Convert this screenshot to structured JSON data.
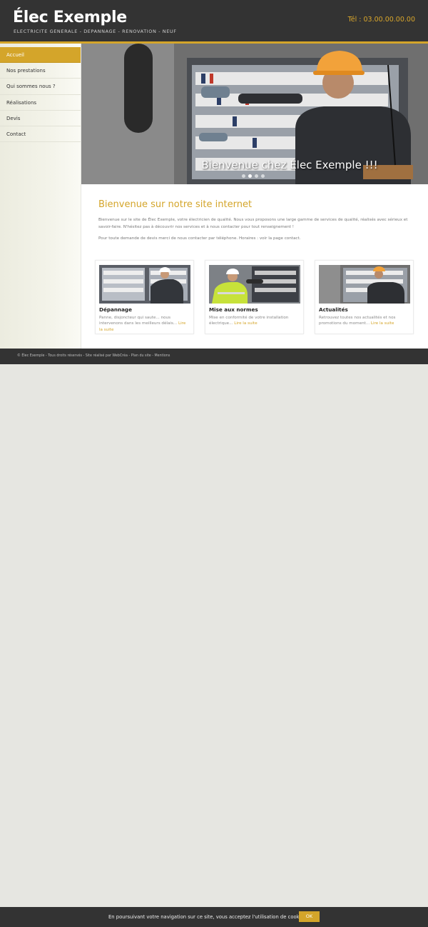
{
  "header": {
    "site_name": "Élec Exemple",
    "tagline": "ELECTRICITE GENERALE - DEPANNAGE - RENOVATION - NEUF",
    "phone": "Tél : 03.00.00.00.00"
  },
  "sidebar": {
    "items": [
      {
        "label": "Accueil",
        "active": true
      },
      {
        "label": "Nos prestations"
      },
      {
        "label": "Qui sommes nous ?"
      },
      {
        "label": "Réalisations"
      },
      {
        "label": "Devis"
      },
      {
        "label": "Contact"
      }
    ]
  },
  "hero": {
    "caption": "Bienvenue chez Élec Exemple !!!",
    "slides": 4,
    "current_slide": 2
  },
  "content": {
    "title": "Bienvenue sur notre site internet",
    "paragraph_1": "Bienvenue sur le site de Élec Exemple, votre électricien de qualité. Nous vous proposons une large gamme de services de qualité, réalisés avec sérieux et savoir-faire. N'hésitez pas à découvrir nos services et à nous contacter pour tout renseignement !",
    "paragraph_2": "Pour toute demande de devis merci de nous contacter par téléphone. Horaires : voir la page contact."
  },
  "cards": [
    {
      "title": "Dépannage",
      "description": "Panne, disjoncteur qui saute... nous intervenons dans les meilleurs délais...",
      "link": "Lire la suite"
    },
    {
      "title": "Mise aux normes",
      "description": "Mise en conformité de votre installation électrique...",
      "link": "Lire la suite"
    },
    {
      "title": "Actualités",
      "description": "Retrouvez toutes nos actualités et nos promotions du moment...",
      "link": "Lire la suite"
    }
  ],
  "footer": {
    "text": "© Élec Exemple - Tous droits réservés - Site réalisé par WebCréa - Plan du site - Mentions"
  },
  "cookie": {
    "message": "En poursuivant votre navigation sur ce site, vous acceptez l'utilisation de cookies.",
    "ok": "OK"
  },
  "colors": {
    "accent": "#d4a52a",
    "dark": "#333333",
    "background": "#e6e6e1"
  }
}
